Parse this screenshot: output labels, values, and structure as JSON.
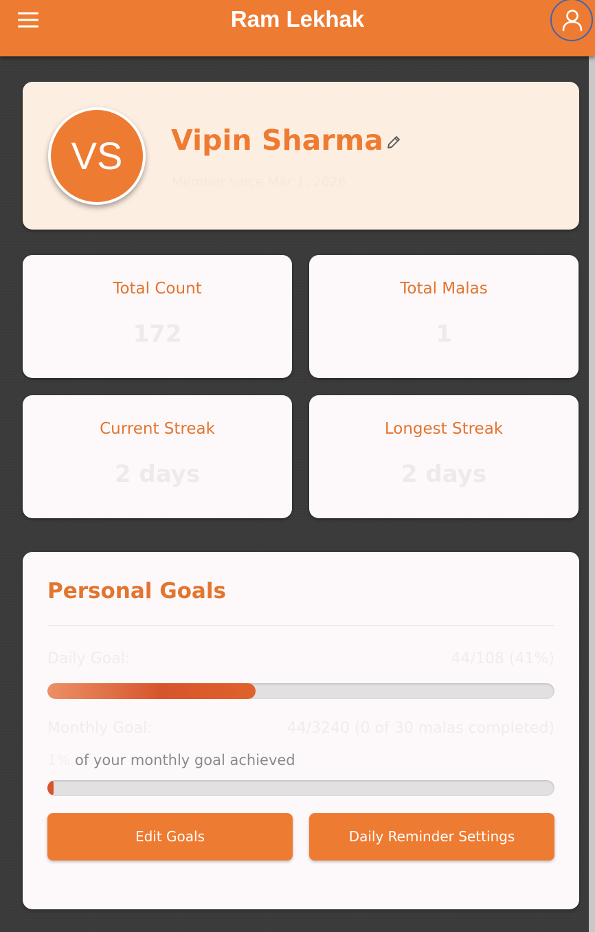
{
  "header": {
    "title": "Ram Lekhak",
    "menu_icon": "hamburger-menu-icon",
    "account_icon": "user-outline-icon"
  },
  "profile": {
    "initials": "VS",
    "name": "Vipin Sharma",
    "member_since": "Member since Mar 1, 2026",
    "edit_icon": "pencil-icon"
  },
  "stats": {
    "total_count": {
      "label": "Total Count",
      "value": "172"
    },
    "total_malas": {
      "label": "Total Malas",
      "value": "1"
    },
    "current_streak": {
      "label": "Current Streak",
      "value": "2 days"
    },
    "longest_streak": {
      "label": "Longest Streak",
      "value": "2 days"
    }
  },
  "goals": {
    "title": "Personal Goals",
    "daily": {
      "label": "Daily Goal:",
      "value": "44/108 (41%)",
      "progress_fraction": 0.41
    },
    "monthly": {
      "label": "Monthly Goal:",
      "value": "44/3240 (0 of 30 malas completed)",
      "progress_fraction": 0.01,
      "achieved_percent": "1%",
      "achieved_text": " of your monthly goal achieved"
    },
    "edit_button": "Edit Goals",
    "reminder_button": "Daily Reminder Settings"
  },
  "colors": {
    "primary": "#ee7b32",
    "primary_text": "#e2752f",
    "profile_card_bg": "#fdeee2",
    "card_bg": "#fdf9fb",
    "page_bg": "#3a3a3a",
    "progress_fill": "#d6552b"
  }
}
